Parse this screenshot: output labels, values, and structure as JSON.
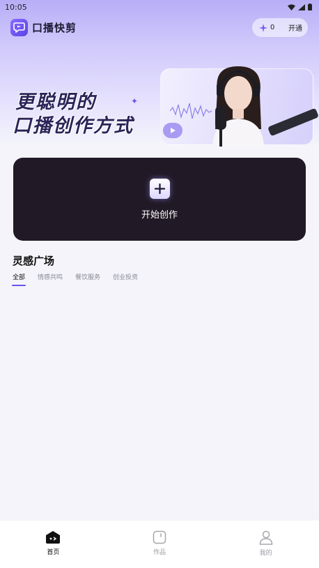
{
  "status_bar": {
    "time": "10:05",
    "icons": [
      "wifi-icon",
      "signal-icon",
      "battery-icon"
    ]
  },
  "header": {
    "app_title": "口播快剪",
    "vip": {
      "count": "0",
      "action_label": "开通"
    }
  },
  "banner": {
    "headline_line1": "更聪明的",
    "headline_line2": "口播创作方式"
  },
  "create_card": {
    "label": "开始创作"
  },
  "inspiration": {
    "title": "灵感广场",
    "tabs": [
      {
        "label": "全部",
        "active": true
      },
      {
        "label": "情感共鸣",
        "active": false
      },
      {
        "label": "餐饮服务",
        "active": false
      },
      {
        "label": "创业投资",
        "active": false
      }
    ]
  },
  "bottom_nav": {
    "items": [
      {
        "label": "首页",
        "icon": "home-icon",
        "active": true
      },
      {
        "label": "作品",
        "icon": "works-icon",
        "active": false
      },
      {
        "label": "我的",
        "icon": "profile-icon",
        "active": false
      }
    ]
  },
  "colors": {
    "accent": "#6b55f0",
    "card_dark": "#211a26",
    "page_bg": "#f4f4fa"
  }
}
